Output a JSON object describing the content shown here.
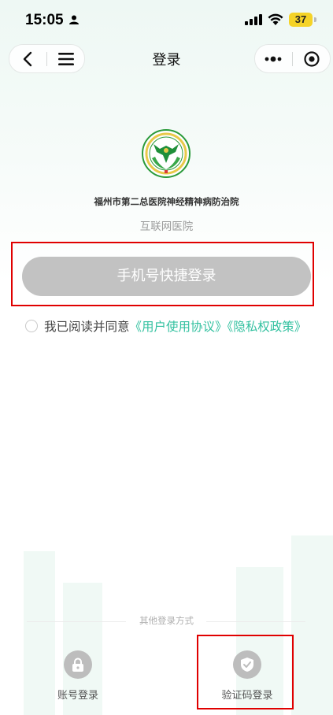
{
  "status_bar": {
    "time": "15:05",
    "battery": "37",
    "icons": [
      "person-icon",
      "signal-icon",
      "wifi-icon",
      "battery-icon"
    ]
  },
  "nav": {
    "title": "登录",
    "back_icon": "back-arrow-icon",
    "menu_icon": "menu-icon",
    "more_icon": "more-dots-icon",
    "close_icon": "mini-program-close-icon"
  },
  "hospital": {
    "name": "福州市第二总医院神经精神病防治院",
    "subtitle": "互联网医院",
    "logo_icon": "hospital-logo"
  },
  "login": {
    "phone_button_label": "手机号快捷登录"
  },
  "agreement": {
    "prefix": "我已阅读并同意",
    "user_agreement": "《用户使用协议》",
    "privacy_policy": "《隐私权政策》",
    "checked": false
  },
  "other_login": {
    "divider_label": "其他登录方式",
    "options": [
      {
        "label": "账号登录",
        "icon": "lock-icon"
      },
      {
        "label": "验证码登录",
        "icon": "shield-check-icon"
      }
    ]
  },
  "colors": {
    "accent": "#33c1a0",
    "button_disabled": "#c2c2c2",
    "highlight_box": "#e00000",
    "battery": "#f5d327"
  }
}
